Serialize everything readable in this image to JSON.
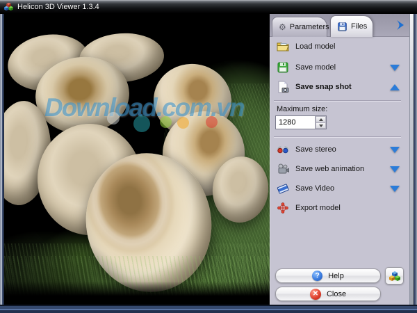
{
  "window": {
    "title": "Helicon 3D Viewer 1.3.4"
  },
  "tabs": [
    {
      "label": "Parameters",
      "active": false
    },
    {
      "label": "Files",
      "active": true
    }
  ],
  "panel": {
    "actions": [
      {
        "label": "Load model",
        "icon": "open-folder-icon",
        "dropdown": "none"
      },
      {
        "label": "Save model",
        "icon": "green-floppy-icon",
        "dropdown": "down"
      },
      {
        "label": "Save snap shot",
        "icon": "page-camera-icon",
        "dropdown": "up"
      },
      {
        "label": "Save stereo",
        "icon": "stereo-glasses-icon",
        "dropdown": "down"
      },
      {
        "label": "Save web animation",
        "icon": "movie-camera-icon",
        "dropdown": "down"
      },
      {
        "label": "Save Video",
        "icon": "film-clip-icon",
        "dropdown": "down"
      },
      {
        "label": "Export model",
        "icon": "molecule-icon",
        "dropdown": "none"
      }
    ],
    "max_size": {
      "label": "Maximum size:",
      "value": "1280"
    },
    "help_label": "Help",
    "close_label": "Close"
  },
  "watermark": {
    "text": "Download.com.vn"
  },
  "icons": {
    "app_logo": "helicon-cubes-logo",
    "tab_parameters": "gear-icon",
    "tab_files": "blue-floppy-icon",
    "help": "blue-question-icon",
    "close": "red-x-icon",
    "logo_button": "helicon-cubes-icon",
    "gear_glyph": "⚙",
    "help_glyph": "?",
    "close_glyph": "✕"
  },
  "colors": {
    "panel_bg": "#c6c4d2",
    "dropdown_arrow_blue": "#2b7cd9",
    "tab_arrow_blue": "#1d6fd1",
    "help_icon_blue": "#2a6fd4",
    "close_icon_red": "#d42a1e"
  }
}
